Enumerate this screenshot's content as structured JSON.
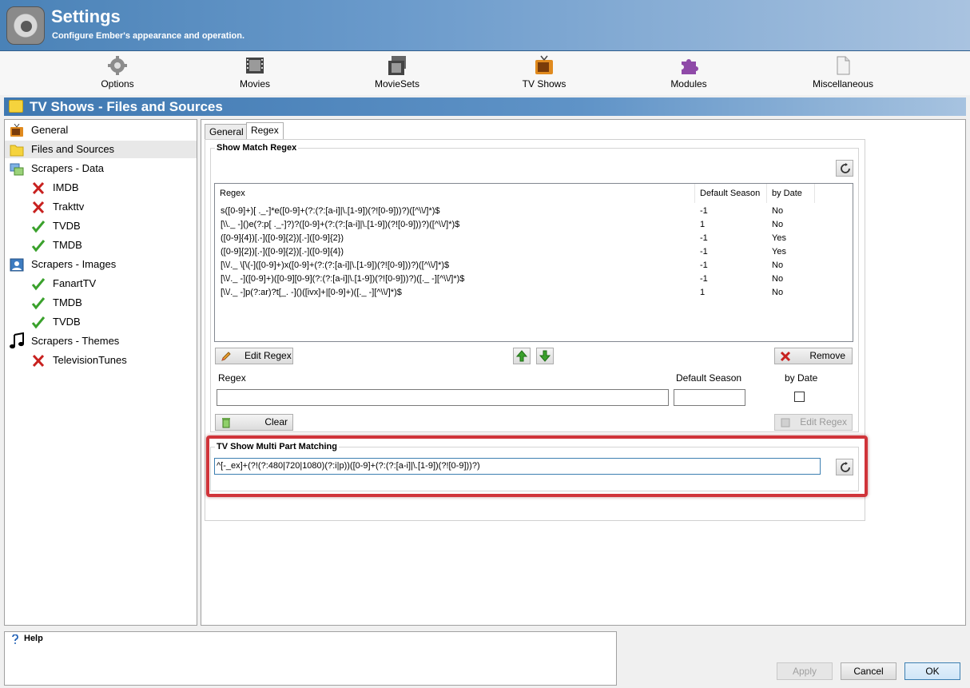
{
  "header": {
    "title": "Settings",
    "subtitle": "Configure Ember's appearance and operation."
  },
  "toolbar": {
    "items": [
      {
        "label": "Options",
        "icon": "gear-icon"
      },
      {
        "label": "Movies",
        "icon": "film-icon"
      },
      {
        "label": "MovieSets",
        "icon": "filmstack-icon"
      },
      {
        "label": "TV Shows",
        "icon": "tv-icon"
      },
      {
        "label": "Modules",
        "icon": "puzzle-icon"
      },
      {
        "label": "Miscellaneous",
        "icon": "document-icon"
      }
    ]
  },
  "section": {
    "title": "TV Shows - Files and Sources"
  },
  "tree": {
    "items": [
      {
        "label": "General",
        "icon": "tv-icon"
      },
      {
        "label": "Files and Sources",
        "icon": "folder-icon",
        "selected": true
      },
      {
        "label": "Scrapers - Data",
        "icon": "data-icon"
      },
      {
        "label": "IMDB",
        "icon": "cross-icon"
      },
      {
        "label": "Trakttv",
        "icon": "cross-icon"
      },
      {
        "label": "TVDB",
        "icon": "check-icon"
      },
      {
        "label": "TMDB",
        "icon": "check-icon"
      },
      {
        "label": "Scrapers - Images",
        "icon": "image-icon"
      },
      {
        "label": "FanartTV",
        "icon": "check-icon"
      },
      {
        "label": "TMDB",
        "icon": "check-icon"
      },
      {
        "label": "TVDB",
        "icon": "check-icon"
      },
      {
        "label": "Scrapers - Themes",
        "icon": "music-icon"
      },
      {
        "label": "TelevisionTunes",
        "icon": "cross-icon"
      }
    ]
  },
  "tabs": [
    {
      "label": "General",
      "active": false
    },
    {
      "label": "Regex",
      "active": true
    }
  ],
  "show_match": {
    "group_label": "Show Match Regex",
    "columns": [
      "Regex",
      "Default Season",
      "by Date"
    ],
    "rows": [
      {
        "regex": "s([0-9]+)[ ._-]*e([0-9]+(?:(?:[a-i]|\\.[1-9])(?![0-9]))?)([^\\\\/]*)$",
        "season": "-1",
        "by_date": "No"
      },
      {
        "regex": "[\\\\._ -]()e(?:p[ ._-]?)?([0-9]+(?:(?:[a-i]|\\.[1-9])(?![0-9]))?)([^\\\\/]*)$",
        "season": "1",
        "by_date": "No"
      },
      {
        "regex": "([0-9]{4})[.-]([0-9]{2})[.-]([0-9]{2})",
        "season": "-1",
        "by_date": "Yes"
      },
      {
        "regex": "([0-9]{2})[.-]([0-9]{2})[.-]([0-9]{4})",
        "season": "-1",
        "by_date": "Yes"
      },
      {
        "regex": "[\\\\/._ \\[\\(-]([0-9]+)x([0-9]+(?:(?:[a-i]|\\.[1-9])(?![0-9]))?)([^\\\\/]*)$",
        "season": "-1",
        "by_date": "No"
      },
      {
        "regex": "[\\\\/._ -]([0-9]+)([0-9][0-9](?:(?:[a-i]|\\.[1-9])(?![0-9]))?)([._ -][^\\\\/]*)$",
        "season": "-1",
        "by_date": "No"
      },
      {
        "regex": "[\\\\/._ -]p(?:ar)?t[_. -]()([ivx]+|[0-9]+)([._ -][^\\\\/]*)$",
        "season": "1",
        "by_date": "No"
      }
    ],
    "edit_button": "Edit Regex",
    "remove_button": "Remove",
    "regex_label": "Regex",
    "season_label": "Default Season",
    "by_date_label": "by Date",
    "regex_value": "",
    "season_value": "",
    "clear_button": "Clear",
    "edit_regex_button": "Edit Regex"
  },
  "multi_part": {
    "group_label": "TV Show Multi Part Matching",
    "value": "^[-_ex]+(?!(?:480|720|1080)(?:i|p))([0-9]+(?:(?:[a-i]|\\.[1-9])(?![0-9]))?)"
  },
  "help": {
    "label": "Help"
  },
  "buttons": {
    "apply": "Apply",
    "cancel": "Cancel",
    "ok": "OK"
  },
  "colors": {
    "highlight": "#d0343a",
    "header": "#4a82b7"
  }
}
